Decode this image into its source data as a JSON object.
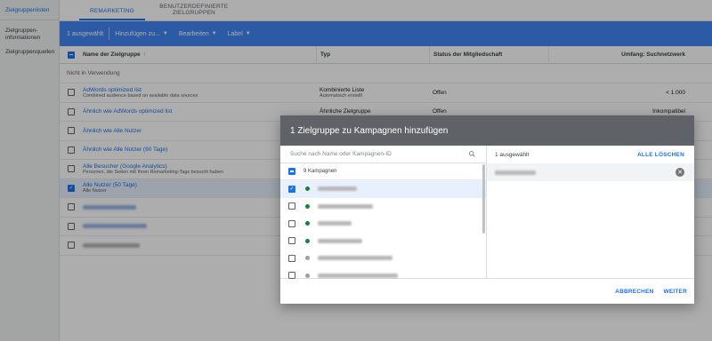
{
  "sidebar": {
    "items": [
      {
        "label": "Zielgruppenlisten",
        "active": true
      },
      {
        "label": "Zielgruppen-informationen",
        "active": false
      },
      {
        "label": "Zielgruppenquellen",
        "active": false
      }
    ]
  },
  "tabs": [
    {
      "label": "REMARKETING",
      "active": true
    },
    {
      "label": "BENUTZERDEFINIERTE ZIELGRUPPEN",
      "active": false
    }
  ],
  "toolbar": {
    "selected_count": "1 ausgewählt",
    "add_label": "Hinzufügen zu...",
    "edit_label": "Bearbeiten",
    "label_label": "Label"
  },
  "table": {
    "headers": {
      "name": "Name der Zielgruppe",
      "type": "Typ",
      "status": "Status der Mitgliedschaft",
      "scope": "Umfang: Suchnetzwerk"
    },
    "section_label": "Nicht in Verwendung",
    "rows": [
      {
        "name": "AdWords optimized list",
        "sub": "Combined audience based on available data sources",
        "type": "Kombinierte Liste",
        "type_sub": "Automatisch erstellt",
        "status": "Offen",
        "scope": "< 1.000",
        "checked": false
      },
      {
        "name": "Ähnlich wie AdWords optimized list",
        "sub": "",
        "type": "Ähnliche Zielgruppe",
        "type_sub": "",
        "status": "Offen",
        "scope": "Inkompatibel",
        "checked": false
      },
      {
        "name": "Ähnlich wie Alle Nutzer",
        "sub": "",
        "type": "",
        "type_sub": "",
        "status": "",
        "scope": "",
        "checked": false
      },
      {
        "name": "Ähnlich wie Alle Nutzer (90 Tage)",
        "sub": "",
        "type": "",
        "type_sub": "",
        "status": "",
        "scope": "",
        "checked": false
      },
      {
        "name": "Alle Besucher (Google Analytics)",
        "sub": "Personen, die Seiten mit Ihren Remarketing-Tags besucht haben",
        "type": "",
        "type_sub": "",
        "status": "",
        "scope": "",
        "checked": false
      },
      {
        "name": "Alle Nutzer (50 Tage)",
        "sub": "Alle Nutzer",
        "type": "",
        "type_sub": "",
        "status": "",
        "scope": "",
        "checked": true
      }
    ]
  },
  "dialog": {
    "title": "1 Zielgruppe zu Kampagnen hinzufügen",
    "search_placeholder": "Suche nach Name oder Kampagnen-ID",
    "campaign_count": "9 Kampagnen",
    "campaigns": [
      {
        "status": "enabled",
        "checked": true
      },
      {
        "status": "enabled",
        "checked": false
      },
      {
        "status": "enabled",
        "checked": false
      },
      {
        "status": "enabled",
        "checked": false
      },
      {
        "status": "paused",
        "checked": false
      },
      {
        "status": "paused",
        "checked": false
      }
    ],
    "selected_count": "1 ausgewählt",
    "clear_all": "ALLE LÖSCHEN",
    "cancel": "ABBRECHEN",
    "next": "WEITER"
  },
  "colors": {
    "accent": "#1a73e8",
    "toolbar_bg": "#4285f4",
    "dialog_header": "#5f6368",
    "enabled": "#188038",
    "paused": "#9aa0a6"
  }
}
